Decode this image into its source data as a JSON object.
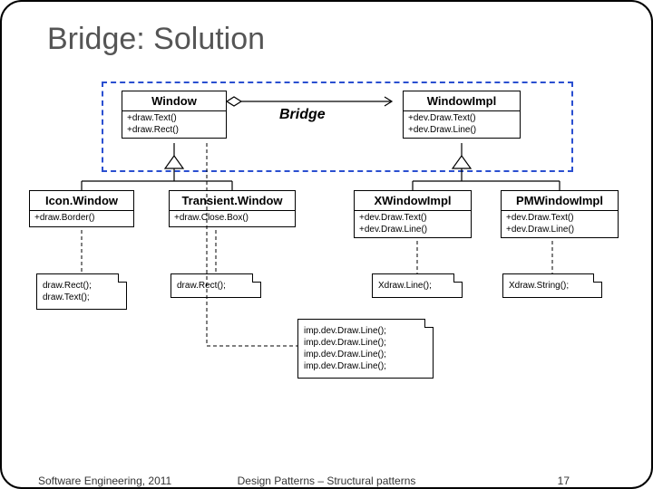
{
  "title": "Bridge: Solution",
  "bridge_label": "Bridge",
  "classes": {
    "window": {
      "name": "Window",
      "ops": [
        "+draw.Text()",
        "+draw.Rect()"
      ]
    },
    "windowimpl": {
      "name": "WindowImpl",
      "ops": [
        "+dev.Draw.Text()",
        "+dev.Draw.Line()"
      ]
    },
    "iconwindow": {
      "name": "Icon.Window",
      "ops": [
        "+draw.Border()"
      ]
    },
    "transientwindow": {
      "name": "Transient.Window",
      "ops": [
        "+draw.Close.Box()"
      ]
    },
    "xwindowimpl": {
      "name": "XWindowImpl",
      "ops": [
        "+dev.Draw.Text()",
        "+dev.Draw.Line()"
      ]
    },
    "pmwindowimpl": {
      "name": "PMWindowImpl",
      "ops": [
        "+dev.Draw.Text()",
        "+dev.Draw.Line()"
      ]
    }
  },
  "notes": {
    "iconwindow_note": [
      "draw.Rect();",
      "draw.Text();"
    ],
    "transientwindow_note": [
      "draw.Rect();"
    ],
    "xwindowimpl_note": [
      "Xdraw.Line();"
    ],
    "pmwindowimpl_note": [
      "Xdraw.String();"
    ],
    "window_note": [
      "imp.dev.Draw.Line();",
      "imp.dev.Draw.Line();",
      "imp.dev.Draw.Line();",
      "imp.dev.Draw.Line();"
    ]
  },
  "footer": {
    "left": "Software Engineering, 2011",
    "center": "Design Patterns – Structural patterns",
    "right": "17"
  }
}
